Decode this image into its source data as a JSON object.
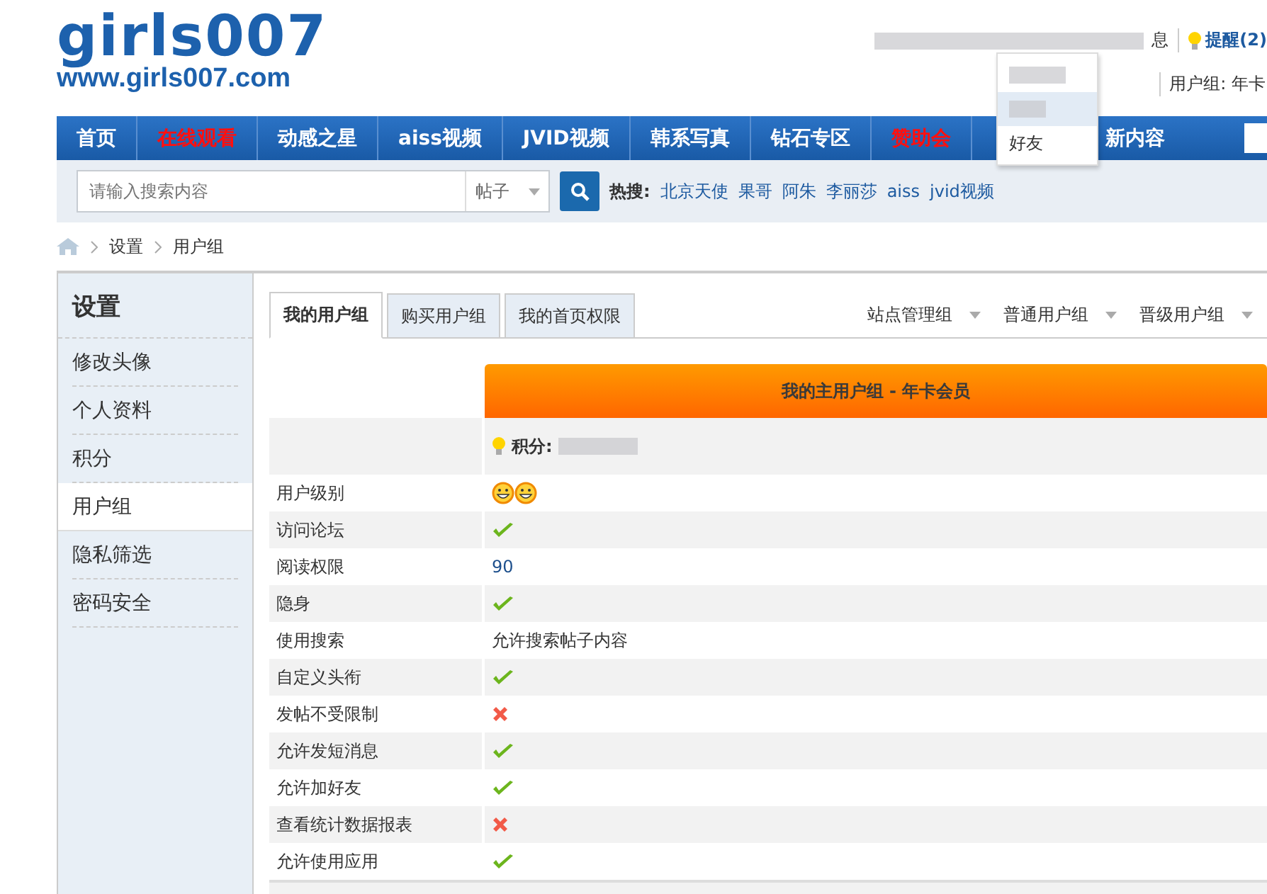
{
  "logo": {
    "name": "girls007",
    "url": "www.girls007.com"
  },
  "top_bar": {
    "messages_tail": "息",
    "reminders": "提醒(2)",
    "user_group": "用户组: 年卡"
  },
  "user_menu": {
    "items": [
      {
        "blurred": true,
        "selected": false
      },
      {
        "blurred": true,
        "selected": true
      },
      {
        "label": "好友",
        "blurred": false,
        "selected": false
      }
    ]
  },
  "nav": [
    {
      "label": "首页",
      "highlight": false
    },
    {
      "label": "在线观看",
      "highlight": true
    },
    {
      "label": "动感之星",
      "highlight": false
    },
    {
      "label": "aiss视频",
      "highlight": false
    },
    {
      "label": "JVID视频",
      "highlight": false
    },
    {
      "label": "韩系写真",
      "highlight": false
    },
    {
      "label": "钻石专区",
      "highlight": false
    },
    {
      "label": "赞助会",
      "highlight": true
    },
    {
      "label": "新内容",
      "highlight": false
    }
  ],
  "search": {
    "placeholder": "请输入搜索内容",
    "scope": "帖子",
    "hot_label": "热搜:",
    "hot": [
      "北京天使",
      "果哥",
      "阿朱",
      "李丽莎",
      "aiss",
      "jvid视频"
    ]
  },
  "breadcrumb": [
    "设置",
    "用户组"
  ],
  "sidebar": {
    "title": "设置",
    "items": [
      {
        "label": "修改头像",
        "selected": false
      },
      {
        "label": "个人资料",
        "selected": false
      },
      {
        "label": "积分",
        "selected": false
      },
      {
        "label": "用户组",
        "selected": true
      },
      {
        "label": "隐私筛选",
        "selected": false
      },
      {
        "label": "密码安全",
        "selected": false
      }
    ]
  },
  "tabs": [
    {
      "label": "我的用户组",
      "selected": true
    },
    {
      "label": "购买用户组",
      "selected": false
    },
    {
      "label": "我的首页权限",
      "selected": false
    }
  ],
  "group_menus": [
    "站点管理组",
    "普通用户组",
    "晋级用户组"
  ],
  "group_header": "我的主用户组 - 年卡会员",
  "points_label": "积分:",
  "rows": [
    {
      "label": "用户级别",
      "kind": "icons",
      "icons": [
        {
          "kind": "smiley"
        },
        {
          "kind": "smiley"
        }
      ]
    },
    {
      "label": "访问论坛",
      "kind": "check",
      "allowed": true
    },
    {
      "label": "阅读权限",
      "kind": "text",
      "value": "90"
    },
    {
      "label": "隐身",
      "kind": "check",
      "allowed": true
    },
    {
      "label": "使用搜索",
      "kind": "text",
      "value": "允许搜索帖子内容"
    },
    {
      "label": "自定义头衔",
      "kind": "check",
      "allowed": true
    },
    {
      "label": "发帖不受限制",
      "kind": "check",
      "allowed": false
    },
    {
      "label": "允许发短消息",
      "kind": "check",
      "allowed": true
    },
    {
      "label": "允许加好友",
      "kind": "check",
      "allowed": true
    },
    {
      "label": "查看统计数据报表",
      "kind": "check",
      "allowed": false
    },
    {
      "label": "允许使用应用",
      "kind": "check",
      "allowed": true
    }
  ]
}
